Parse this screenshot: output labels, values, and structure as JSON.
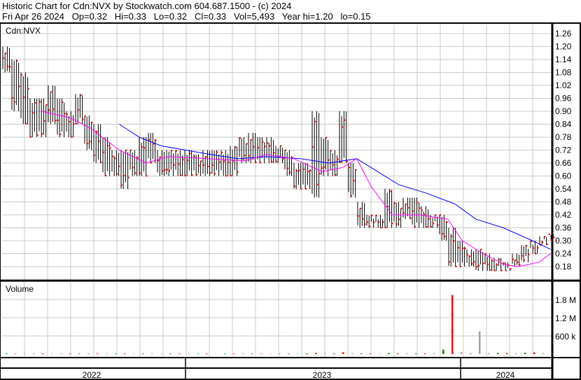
{
  "header": {
    "title": "Historic Chart for Cdn:NVX by Stockwatch.com 604.687.1500 - (c) 2024",
    "quote": "Fri Apr 26 2024   Op=0.32   Hi=0.33   Lo=0.32   Cl=0.33   Vol=5,493   Year hi=1.20   lo=0.15"
  },
  "chart_data": [
    {
      "type": "ohlc",
      "title": "Cdn:NVX",
      "yticks": [
        "1.26",
        "1.20",
        "1.14",
        "1.08",
        "1.02",
        "0.96",
        "0.90",
        "0.84",
        "0.78",
        "0.72",
        "0.66",
        "0.60",
        "0.54",
        "0.48",
        "0.42",
        "0.36",
        "0.30",
        "0.24",
        "0.18"
      ],
      "ylim": [
        0.12,
        1.29
      ],
      "bars": [
        [
          1.2,
          1.08
        ],
        [
          1.14,
          0.9
        ],
        [
          1.08,
          0.84
        ],
        [
          0.96,
          0.78
        ],
        [
          0.96,
          0.78
        ],
        [
          1.02,
          0.84
        ],
        [
          0.96,
          0.78
        ],
        [
          0.9,
          0.78
        ],
        [
          0.98,
          0.84
        ],
        [
          0.88,
          0.72
        ],
        [
          0.84,
          0.66
        ],
        [
          0.78,
          0.6
        ],
        [
          0.72,
          0.6
        ],
        [
          0.72,
          0.54
        ],
        [
          0.72,
          0.6
        ],
        [
          0.78,
          0.6
        ],
        [
          0.8,
          0.66
        ],
        [
          0.72,
          0.6
        ],
        [
          0.72,
          0.6
        ],
        [
          0.72,
          0.6
        ],
        [
          0.72,
          0.6
        ],
        [
          0.7,
          0.6
        ],
        [
          0.72,
          0.6
        ],
        [
          0.72,
          0.6
        ],
        [
          0.72,
          0.6
        ],
        [
          0.74,
          0.6
        ],
        [
          0.78,
          0.66
        ],
        [
          0.8,
          0.66
        ],
        [
          0.78,
          0.66
        ],
        [
          0.78,
          0.66
        ],
        [
          0.74,
          0.66
        ],
        [
          0.72,
          0.6
        ],
        [
          0.66,
          0.54
        ],
        [
          0.66,
          0.54
        ],
        [
          0.9,
          0.5
        ],
        [
          0.78,
          0.6
        ],
        [
          0.72,
          0.6
        ],
        [
          0.9,
          0.66
        ],
        [
          0.66,
          0.5
        ],
        [
          0.48,
          0.36
        ],
        [
          0.42,
          0.36
        ],
        [
          0.42,
          0.36
        ],
        [
          0.54,
          0.36
        ],
        [
          0.48,
          0.36
        ],
        [
          0.5,
          0.4
        ],
        [
          0.5,
          0.36
        ],
        [
          0.46,
          0.36
        ],
        [
          0.42,
          0.36
        ],
        [
          0.42,
          0.3
        ],
        [
          0.36,
          0.18
        ],
        [
          0.3,
          0.18
        ],
        [
          0.26,
          0.18
        ],
        [
          0.26,
          0.16
        ],
        [
          0.24,
          0.16
        ],
        [
          0.22,
          0.16
        ],
        [
          0.2,
          0.16
        ],
        [
          0.24,
          0.18
        ],
        [
          0.28,
          0.2
        ],
        [
          0.3,
          0.24
        ],
        [
          0.32,
          0.28
        ],
        [
          0.33,
          0.3
        ]
      ],
      "ma_long": [
        [
          12.8,
          0.84
        ],
        [
          15,
          0.78
        ],
        [
          17.4,
          0.74
        ],
        [
          22.8,
          0.7
        ],
        [
          25.9,
          0.68
        ],
        [
          29,
          0.69
        ],
        [
          32.8,
          0.68
        ],
        [
          35.8,
          0.66
        ],
        [
          38.9,
          0.68
        ],
        [
          41.2,
          0.62
        ],
        [
          43.5,
          0.56
        ],
        [
          46.6,
          0.52
        ],
        [
          49.7,
          0.47
        ],
        [
          52,
          0.4
        ],
        [
          55,
          0.36
        ],
        [
          58.2,
          0.3
        ],
        [
          60.2,
          0.26
        ]
      ],
      "ma_short": [
        [
          4.3,
          0.9
        ],
        [
          7.4,
          0.87
        ],
        [
          9.7,
          0.82
        ],
        [
          12.8,
          0.72
        ],
        [
          15.8,
          0.66
        ],
        [
          18.2,
          0.69
        ],
        [
          22.8,
          0.68
        ],
        [
          26.6,
          0.67
        ],
        [
          29,
          0.7
        ],
        [
          32,
          0.68
        ],
        [
          35.1,
          0.62
        ],
        [
          37.4,
          0.64
        ],
        [
          38.9,
          0.68
        ],
        [
          40.5,
          0.55
        ],
        [
          42.8,
          0.42
        ],
        [
          45.8,
          0.42
        ],
        [
          48.9,
          0.4
        ],
        [
          50.5,
          0.3
        ],
        [
          52.8,
          0.24
        ],
        [
          55.1,
          0.19
        ],
        [
          56.6,
          0.18
        ],
        [
          58.9,
          0.2
        ],
        [
          60.2,
          0.24
        ]
      ]
    },
    {
      "type": "bar",
      "title": "Volume",
      "yticks": [
        "1.8 M",
        "1.2 M",
        "600 k"
      ],
      "ytick_values": [
        1800000,
        1200000,
        600000
      ],
      "ymax": 2100000,
      "values": [
        20000,
        15000,
        18000,
        12000,
        25000,
        15000,
        14000,
        20000,
        30000,
        15000,
        22000,
        18000,
        15000,
        20000,
        15000,
        18000,
        12000,
        14000,
        20000,
        16000,
        18000,
        15000,
        20000,
        14000,
        16000,
        18000,
        25000,
        20000,
        15000,
        18000,
        14000,
        16000,
        20000,
        25000,
        40000,
        30000,
        25000,
        60000,
        30000,
        25000,
        20000,
        18000,
        35000,
        25000,
        30000,
        20000,
        25000,
        30000,
        150000,
        1950000,
        60000,
        20000,
        750000,
        30000,
        40000,
        35000,
        25000,
        45000,
        55000,
        30000,
        20000
      ],
      "colors": [
        "red",
        "green",
        "gray"
      ],
      "xlabels": [
        "2022",
        "2023",
        "2024"
      ]
    }
  ],
  "colors": {
    "up": "#008000",
    "down": "#ff0000",
    "bar": "#000000",
    "ma_long": "#0000ff",
    "ma_short": "#ff00ff",
    "grid": "#c8c8c8"
  }
}
